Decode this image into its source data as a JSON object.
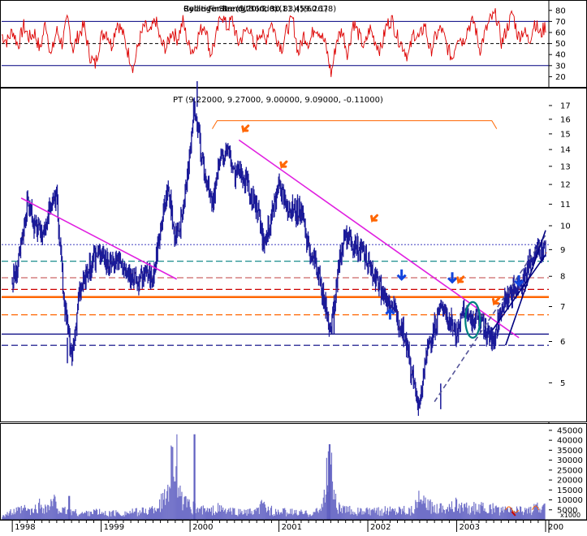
{
  "chart_data": [
    {
      "panel": "indicator",
      "type": "line",
      "title_overlap_texts": [
        "Cycle Finder (5, 360, 30.83)(59.2678)",
        "Relative Strength Index(11.4)(60.1)",
        "Bollinger Band(20, 2.0)"
      ],
      "series": [
        {
          "name": "",
          "color": "#dd0000",
          "values": [
            58,
            52,
            62,
            48,
            66,
            55,
            60,
            44,
            70,
            38,
            62,
            50,
            72,
            45,
            58,
            66,
            40,
            30,
            55,
            62,
            48,
            70,
            60,
            42,
            28,
            52,
            66,
            58,
            72,
            50,
            46,
            62,
            54,
            70,
            48,
            44,
            60,
            68,
            40,
            55,
            78,
            64,
            72,
            50,
            58,
            66,
            44,
            62,
            52,
            70,
            56,
            46,
            64,
            72,
            40,
            58,
            50,
            66,
            60,
            48,
            22,
            54,
            62,
            40,
            70,
            58,
            46,
            64,
            52,
            44,
            66,
            72,
            56,
            48,
            38,
            60,
            54,
            68,
            42,
            56,
            64,
            48,
            36,
            58,
            52,
            66,
            70,
            44,
            60,
            72,
            76,
            50,
            64,
            78,
            56,
            62,
            52,
            70,
            58,
            66
          ]
        }
      ],
      "y_ticks": [
        "80",
        "70",
        "60",
        "50",
        "40",
        "30",
        "20"
      ],
      "ylim": [
        10,
        85
      ],
      "reference_lines": [
        {
          "value": 70,
          "style": "solid",
          "color": "#000080"
        },
        {
          "value": 50,
          "style": "dashed",
          "color": "#000000"
        },
        {
          "value": 30,
          "style": "solid",
          "color": "#000080"
        }
      ]
    },
    {
      "panel": "price",
      "type": "bar",
      "subtitle": "PT (9.22000, 9.27000, 9.00000, 9.09000, -0.11000)",
      "y_scale": "log",
      "ylim": [
        4.2,
        18
      ],
      "y_ticks": [
        "17",
        "16",
        "15",
        "14",
        "13",
        "12",
        "11",
        "10",
        "9",
        "8",
        "7",
        "6",
        "5"
      ],
      "x_ticks": [
        "1998",
        "1999",
        "2000",
        "2001",
        "2002",
        "2003",
        "200"
      ],
      "x": [
        1998.0,
        1998.08,
        1998.17,
        1998.25,
        1998.33,
        1998.42,
        1998.5,
        1998.58,
        1998.67,
        1998.75,
        1998.83,
        1998.92,
        1999.0,
        1999.08,
        1999.17,
        1999.25,
        1999.33,
        1999.42,
        1999.5,
        1999.58,
        1999.67,
        1999.75,
        1999.83,
        1999.92,
        2000.0,
        2000.04,
        2000.08,
        2000.17,
        2000.25,
        2000.33,
        2000.42,
        2000.5,
        2000.58,
        2000.67,
        2000.75,
        2000.83,
        2000.92,
        2001.0,
        2001.08,
        2001.17,
        2001.25,
        2001.33,
        2001.42,
        2001.5,
        2001.58,
        2001.67,
        2001.75,
        2001.83,
        2001.92,
        2002.0,
        2002.08,
        2002.17,
        2002.25,
        2002.33,
        2002.42,
        2002.5,
        2002.58,
        2002.67,
        2002.75,
        2002.83,
        2002.92,
        2003.0,
        2003.08,
        2003.17,
        2003.25,
        2003.33,
        2003.42,
        2003.5,
        2003.58,
        2003.67,
        2003.75,
        2003.83,
        2003.92,
        2004.0
      ],
      "close": [
        7.8,
        8.6,
        11.2,
        10.0,
        9.6,
        10.8,
        11.3,
        7.2,
        5.5,
        7.4,
        8.0,
        8.6,
        9.0,
        8.4,
        8.7,
        8.3,
        8.0,
        7.8,
        8.1,
        7.9,
        10.0,
        11.8,
        9.6,
        10.4,
        14.0,
        16.8,
        15.5,
        12.4,
        11.0,
        13.0,
        14.2,
        12.5,
        12.8,
        11.6,
        10.8,
        9.2,
        10.4,
        12.0,
        11.0,
        10.6,
        10.8,
        9.0,
        8.4,
        7.3,
        6.3,
        8.2,
        9.6,
        9.2,
        9.0,
        8.6,
        8.0,
        7.4,
        7.2,
        6.7,
        6.1,
        5.1,
        4.5,
        5.8,
        6.4,
        7.1,
        6.6,
        6.2,
        6.9,
        6.6,
        6.7,
        6.2,
        6.0,
        7.0,
        7.3,
        7.7,
        7.9,
        8.6,
        9.0,
        9.1
      ],
      "horizontal_levels": [
        {
          "value": 9.2,
          "style": "dotted",
          "color": "#6666cc"
        },
        {
          "value": 8.55,
          "style": "dashed",
          "color": "#008080"
        },
        {
          "value": 7.95,
          "style": "dashed",
          "color": "#cc6666"
        },
        {
          "value": 7.55,
          "style": "dashed",
          "color": "#cc0000"
        },
        {
          "value": 7.3,
          "style": "solid",
          "color": "#ff6600"
        },
        {
          "value": 6.75,
          "style": "dashed",
          "color": "#ff6600"
        },
        {
          "value": 6.2,
          "style": "solid",
          "color": "#000080"
        },
        {
          "value": 5.9,
          "style": "dashed",
          "color": "#000080"
        }
      ],
      "trendlines": [
        {
          "from": [
            1998.1,
            11.3
          ],
          "to": [
            1999.85,
            7.9
          ],
          "color": "#e020e0"
        },
        {
          "from": [
            2000.55,
            14.6
          ],
          "to": [
            2003.7,
            6.1
          ],
          "color": "#e020e0"
        },
        {
          "from": [
            2002.75,
            4.6
          ],
          "to": [
            2004.0,
            9.6
          ],
          "color": "#555599",
          "style": "dashed"
        },
        {
          "from": [
            2003.55,
            5.9
          ],
          "to": [
            2004.0,
            9.8
          ],
          "color": "#000080"
        },
        {
          "from": [
            2003.4,
            6.3
          ],
          "to": [
            2004.0,
            8.8
          ],
          "color": "#000080"
        }
      ],
      "annotations": [
        {
          "type": "arrow-down-orange",
          "x": 2000.6,
          "y": 15.0
        },
        {
          "type": "arrow-down-orange",
          "x": 2001.03,
          "y": 12.8
        },
        {
          "type": "arrow-down-orange",
          "x": 2002.05,
          "y": 10.1
        },
        {
          "type": "arrow-down-blue",
          "x": 2002.38,
          "y": 7.9
        },
        {
          "type": "arrow-up-blue",
          "x": 2002.25,
          "y": 6.9
        },
        {
          "type": "arrow-down-blue",
          "x": 2002.95,
          "y": 7.8
        },
        {
          "type": "arrow-down-orange",
          "x": 2003.02,
          "y": 7.7
        },
        {
          "type": "arrow-down-orange",
          "x": 2003.42,
          "y": 7.0
        },
        {
          "type": "arrow-down-blue",
          "x": 2003.7,
          "y": 7.7
        },
        {
          "type": "ellipse-teal",
          "x": 2003.18,
          "y": 6.6
        },
        {
          "type": "cycle-bracket",
          "x_from": 2000.25,
          "x_to": 2003.45,
          "y": 15.9
        }
      ]
    },
    {
      "panel": "volume",
      "type": "bar",
      "y_ticks": [
        "45000",
        "40000",
        "35000",
        "30000",
        "25000",
        "20000",
        "15000",
        "10000",
        "5000"
      ],
      "y_tick_extra": "x1000",
      "ylim": [
        0,
        47000
      ],
      "values": [
        3000,
        4200,
        5200,
        6500,
        4800,
        9000,
        7200,
        11000,
        5000,
        6000,
        4200,
        3800,
        5500,
        4500,
        3600,
        4100,
        3900,
        4400,
        4800,
        5200,
        6000,
        9000,
        14000,
        43000,
        12000,
        8500,
        7000,
        6000,
        5200,
        6800,
        5500,
        5000,
        4600,
        4800,
        4200,
        9000,
        6200,
        4000,
        5000,
        4500,
        4300,
        4000,
        4800,
        6500,
        38000,
        8000,
        6000,
        5500,
        5200,
        5000,
        4800,
        5600,
        6000,
        6200,
        7000,
        5800,
        12000,
        9500,
        7800,
        8500,
        7400,
        9000,
        7600,
        6600,
        8000,
        6400,
        6800,
        5400,
        5800,
        6200,
        6000,
        6400,
        7000,
        6600
      ]
    }
  ]
}
